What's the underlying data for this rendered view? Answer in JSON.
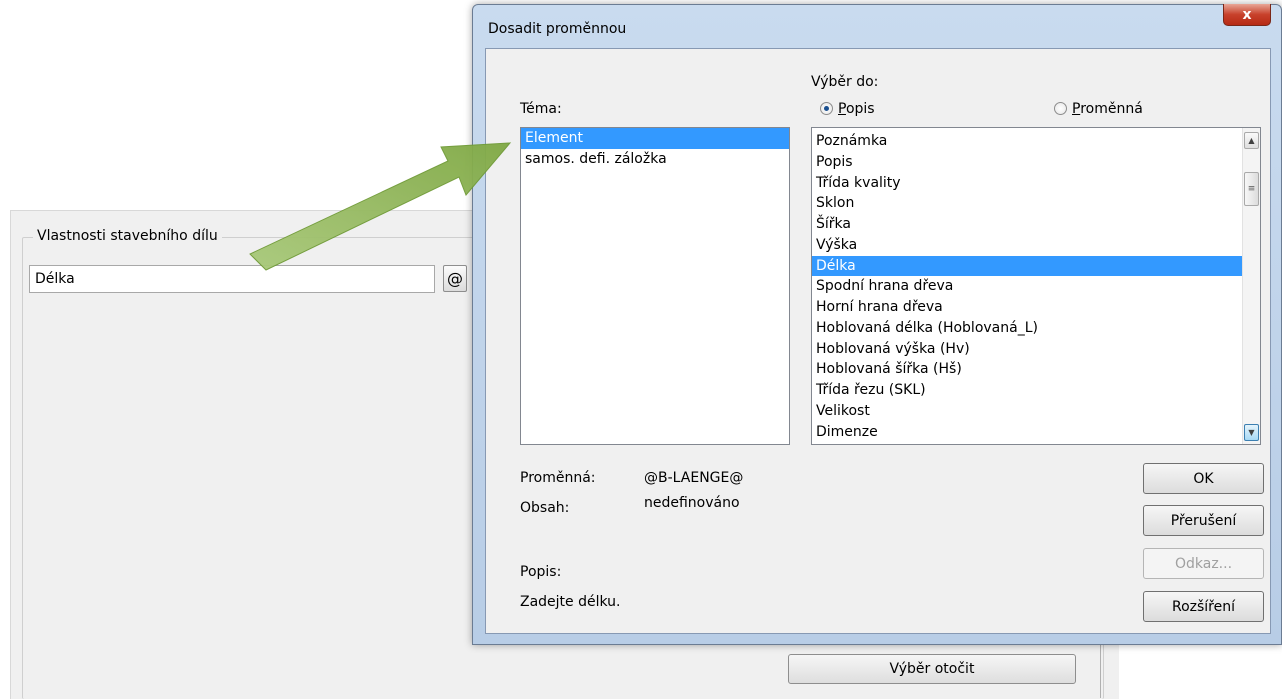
{
  "background_window": {
    "group_title": "Vlastnosti stavebního dílu",
    "field_value": "Délka",
    "at_button": "@",
    "rotate_button": "Výběr otočit"
  },
  "dialog": {
    "title": "Dosadit proměnnou",
    "close_icon": "x",
    "theme_label": "Téma:",
    "select_into_label": "Výběr do:",
    "radio_popis": {
      "accel": "P",
      "rest": "opis",
      "checked": true
    },
    "radio_promenna": {
      "accel": "P",
      "rest": "roměnná",
      "checked": false
    },
    "theme_items": [
      "Element",
      "samos. defi. záložka"
    ],
    "theme_selected_index": 0,
    "variables": [
      "Poznámka",
      "Popis",
      "Třída kvality",
      "Sklon",
      "Šířka",
      "Výška",
      "Délka",
      "Spodní hrana dřeva",
      "Horní hrana dřeva",
      "Hoblovaná délka (Hoblovaná_L)",
      "Hoblovaná výška (Hv)",
      "Hoblovaná šířka (Hš)",
      "Třída řezu (SKL)",
      "Velikost",
      "Dimenze"
    ],
    "variables_selected_index": 6,
    "info": {
      "variable_label": "Proměnná:",
      "variable_value": "@B-LAENGE@",
      "content_label": "Obsah:",
      "content_value": "nedefinováno",
      "description_label": "Popis:",
      "description_value": "Zadejte délku."
    },
    "buttons": {
      "ok": "OK",
      "cancel": "Přerušení",
      "link": "Odkaz...",
      "extend": "Rozšíření"
    }
  },
  "colors": {
    "selection": "#3399ff",
    "arrow": "#8db550"
  },
  "icons": [
    "close-icon",
    "scroll-up-icon",
    "scroll-down-icon",
    "scroll-grip-icon",
    "arrow-annotation"
  ]
}
